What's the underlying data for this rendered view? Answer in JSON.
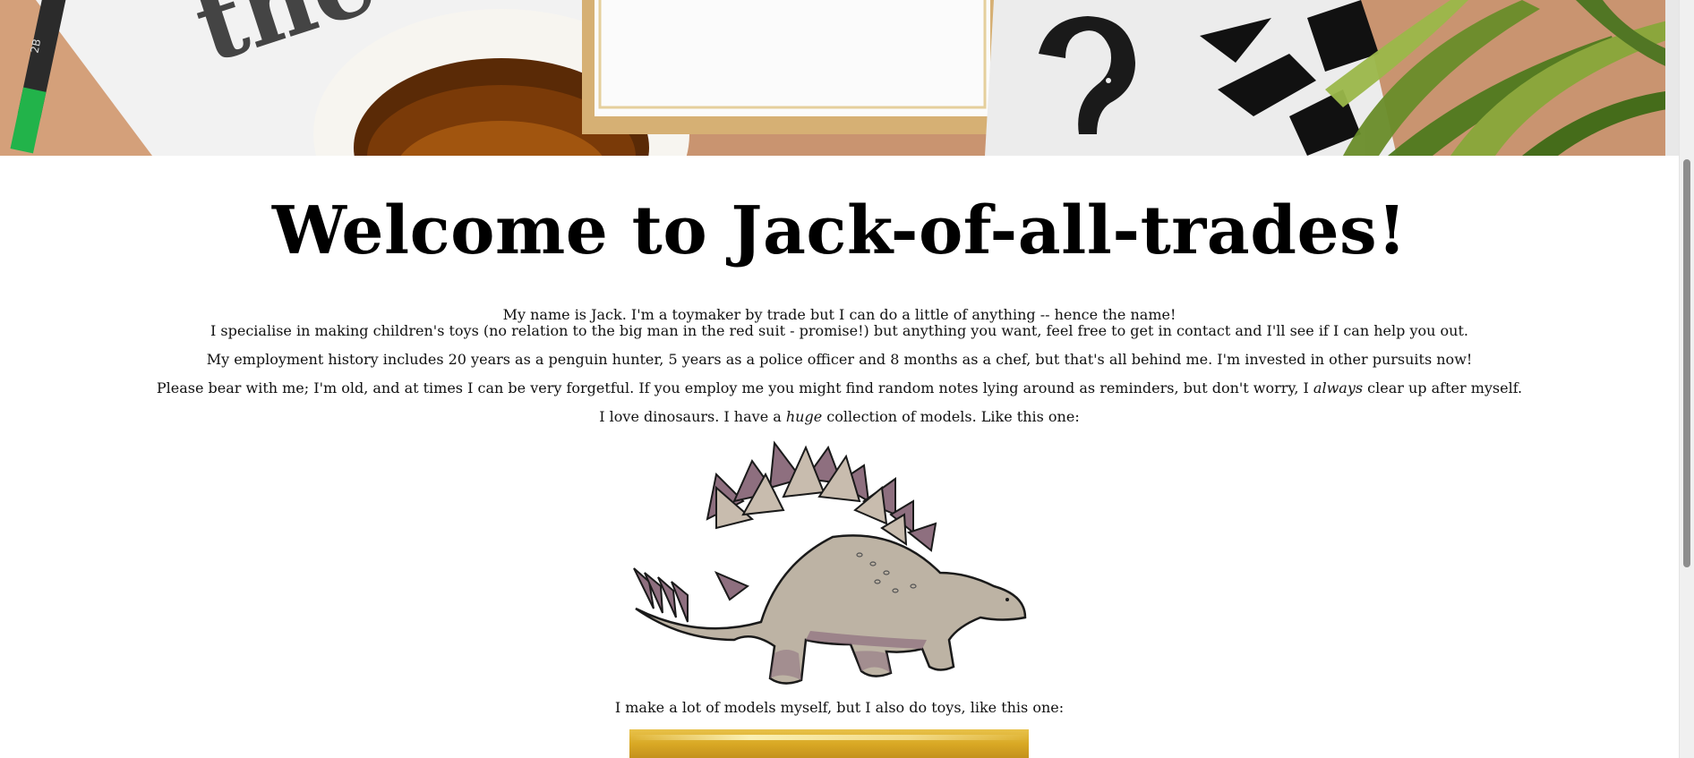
{
  "page": {
    "title": "Welcome to Jack-of-all-trades!",
    "hero_image": "desk-flatlay-banner",
    "paragraphs": {
      "intro_line1": "My name is Jack. I'm a toymaker by trade but I can do a little of anything -- hence the name!",
      "intro_line2": "I specialise in making children's toys (no relation to the big man in the red suit - promise!) but anything you want, feel free to get in contact and I'll see if I can help you out.",
      "employment": "My employment history includes 20 years as a penguin hunter, 5 years as a police officer and 8 months as a chef, but that's all behind me. I'm invested in other pursuits now!",
      "bear_before": "Please bear with me; I'm old, and at times I can be very forgetful. If you employ me you might find random notes lying around as reminders, but don't worry, I ",
      "bear_em": "always",
      "bear_after": " clear up after myself.",
      "dino_before": "I love dinosaurs. I have a ",
      "dino_em": "huge",
      "dino_after": " collection of models. Like this one:",
      "models": "I make a lot of models myself, but I also do toys, like this one:"
    },
    "images": {
      "dinosaur": "stegosaurus-illustration",
      "toy": "toy-photo"
    },
    "colors": {
      "background": "#ffffff",
      "text": "#111111",
      "dino_body": "#bdb3a4",
      "dino_plates": "#8e6f7f"
    }
  }
}
